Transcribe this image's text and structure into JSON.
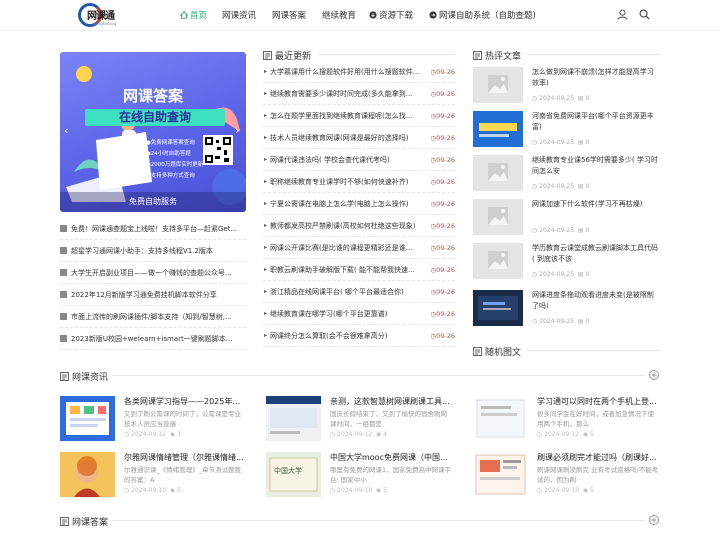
{
  "brand": {
    "name": "网课通",
    "sub": "wangketong"
  },
  "nav": {
    "items": [
      {
        "label": "首页",
        "active": true,
        "icon": "home-icon"
      },
      {
        "label": "网课资讯"
      },
      {
        "label": "网课答案"
      },
      {
        "label": "继续教育"
      },
      {
        "label": "资源下载",
        "icon": "download-icon"
      },
      {
        "label": "网课自助系统（自助查题)",
        "icon": "send-icon"
      }
    ]
  },
  "banner": {
    "title": "网课答案",
    "strip": "在线自助查询",
    "lines": [
      "●免费网课答案查询",
      "●24小时自助答题",
      "●2000万题库实时更新",
      "●支持多种方式查询"
    ],
    "caption": "免费自助服务"
  },
  "left_list": [
    "免费！网课通查题宝上线啦！支持多平台—赶紧Get...",
    "超星学习通网课小助手：支持多线程V1.2版本",
    "大学生开启副业项目——做一个赚钱的查题公众号...",
    "2022年12月新版学习通免费挂机脚本软件分享",
    "市面上流传的刷网课插件/脚本支持（知到/智慧树,...",
    "2023新版U校园+welearn+ismart一键刷题脚本..."
  ],
  "latest": {
    "header": "最近更新",
    "items": [
      {
        "title": "大学慕课用什么搜题软件好用(用什么搜题软件...",
        "date": "09-26"
      },
      {
        "title": "继续教育需要多少课时时间完成(多久能拿到...",
        "date": "09-26"
      },
      {
        "title": "怎么在题学里面找到继续教育课程呢(怎么找...",
        "date": "09-26"
      },
      {
        "title": "技术人员继续教育网课(网课是最好的选择吗)",
        "date": "09-26"
      },
      {
        "title": "网课代课违法吗( 学校会查代课代考吗)",
        "date": "09-26"
      },
      {
        "title": "职称继续教育专业课学时不够(如何快速补齐)",
        "date": "09-26"
      },
      {
        "title": "宁夏公需课在电脑上怎么学(电脑上怎么操作)",
        "date": "09-26"
      },
      {
        "title": "教师都发高校严禁刷课(高校如何杜绝这些现象)",
        "date": "09-26"
      },
      {
        "title": "网课公开课比赛(是比谁的课程更精彩还是谁...",
        "date": "09-26"
      },
      {
        "title": "职教云刷课助手破解版下载( 能不能帮我快速...",
        "date": "09-26"
      },
      {
        "title": "浙江精品在线网课平台( 哪个平台最适合你)",
        "date": "09-26"
      },
      {
        "title": "继续教育课在哪学习(哪个平台更靠谱)",
        "date": "09-26"
      },
      {
        "title": "网课终分怎么算取(会不会很难拿高分)",
        "date": "09-26"
      }
    ]
  },
  "hot": {
    "header": "热评文章",
    "items": [
      {
        "title": "怎么做到网课不崩溃(怎样才能提高学习效率)",
        "date": "2024-09-25",
        "comments": "0",
        "thumb": "placeholder"
      },
      {
        "title": "河南省免费网课平台(哪个平台资源更丰富)",
        "date": "2024-09-25",
        "comments": "0",
        "thumb": "blue"
      },
      {
        "title": "继续教育专业课56学时需要多少( 学习时间怎么安",
        "date": "2024-09-25",
        "comments": "0",
        "thumb": "placeholder"
      },
      {
        "title": "网课加速下什么软件(学习不再枯燥)",
        "date": "2024-09-25",
        "comments": "0",
        "thumb": "placeholder"
      },
      {
        "title": "学历教育云课堂成教云刷课脚本工具代码( 到底该不该",
        "date": "2024-09-25",
        "comments": "0",
        "thumb": "placeholder"
      },
      {
        "title": "网课进度条拖动观看进度未变(是被限制了吗)",
        "date": "2024-09-25",
        "comments": "0",
        "thumb": "dark"
      }
    ]
  },
  "random": {
    "header": "随机图文"
  },
  "news": {
    "header": "网课资讯",
    "cards": [
      {
        "title": "各类网课学习指导——2025年度...",
        "excerpt": "又到了刷公需课的时间了，公需课是专业技术人员应当普遍",
        "date": "2024-09-12",
        "views": "3"
      },
      {
        "title": "亲测，这款智慧树网课刷课工具...",
        "excerpt": "国庆长假结束了，又到了愉快的宿舍刷网课时间。一组都是",
        "date": "2024-09-12",
        "views": "4"
      },
      {
        "title": "学习通可以同时在两个手机上登...",
        "excerpt": "很多同学会在好时间，或者加急情况下使用两个手机，那么",
        "date": "2024-09-12",
        "views": "5"
      },
      {
        "title": "尔雅网课情绪管理（尔雅课情绪...",
        "excerpt": "尔雅通识课_《情绪管理》_章节测试题我的答案：A",
        "date": "2024-09-10",
        "views": "5"
      },
      {
        "title": "中国大学mooc免费网课（中国大...",
        "excerpt": "哪里有免费的网课1，国家免费高中网课平台: 国家中小",
        "date": "2024-09-10",
        "views": "5"
      },
      {
        "title": "刷课必须刷完才能过吗（刷课好...",
        "excerpt": "刷课网课刷没刷完 业有考试资格吗/不能考试的，因为刷",
        "date": "2024-09-10",
        "views": "5"
      }
    ]
  },
  "answers": {
    "header": "网课答案"
  },
  "colors": {
    "accent": "#2aae67",
    "date_red": "#e0463a",
    "banner": "#5b63e8"
  }
}
